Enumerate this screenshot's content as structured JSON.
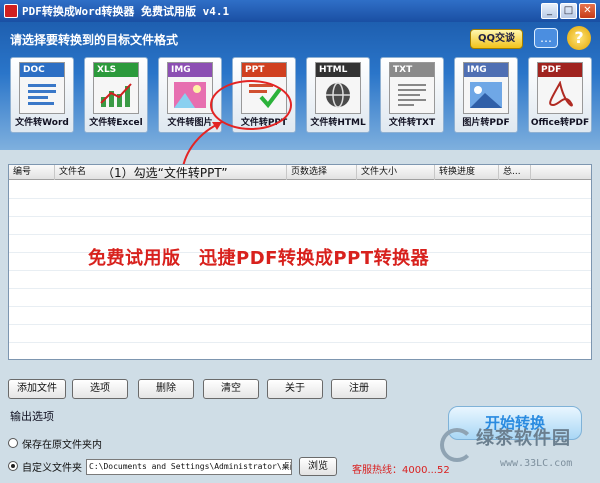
{
  "window": {
    "title": "PDF转换成Word转换器 免费试用版 v4.1"
  },
  "header": {
    "hint": "请选择要转换到的目标文件格式",
    "qq_button": "QQ交谈",
    "help_glyph": "?"
  },
  "tools": [
    {
      "tag": "DOC",
      "label": "文件转Word",
      "tag_color": "#2d6fc4"
    },
    {
      "tag": "XLS",
      "label": "文件转Excel",
      "tag_color": "#2c9a3c"
    },
    {
      "tag": "IMG",
      "label": "文件转图片",
      "tag_color": "#8c4fb3"
    },
    {
      "tag": "PPT",
      "label": "文件转PPT",
      "tag_color": "#d0401f"
    },
    {
      "tag": "HTML",
      "label": "文件转HTML",
      "tag_color": "#333333"
    },
    {
      "tag": "TXT",
      "label": "文件转TXT",
      "tag_color": "#8a8a8a"
    },
    {
      "tag": "IMG",
      "label": "图片转PDF",
      "tag_color": "#4f6fb3"
    },
    {
      "tag": "PDF",
      "label": "Office转PDF",
      "tag_color": "#a0231f"
    }
  ],
  "table": {
    "columns": [
      "编号",
      "文件名",
      "页数选择",
      "文件大小",
      "转换进度",
      "总..."
    ]
  },
  "annotations": {
    "step": "（1）勾选“文件转PPT”",
    "banner": "免费试用版　迅捷PDF转换成PPT转换器"
  },
  "actions": {
    "add_file": "添加文件",
    "options": "选项",
    "delete": "删除",
    "clear": "清空",
    "about": "关于",
    "register": "注册"
  },
  "output": {
    "label": "输出选项",
    "save_original": "保存在原文件夹内",
    "custom_folder": "自定义文件夹",
    "path": "C:\\Documents and Settings\\Administrator\\桌面",
    "browse": "浏览",
    "hotline": "客服热线：4000...52",
    "start": "开始转换"
  },
  "watermark": {
    "name": "绿茶软件园",
    "url": "www.33LC.com"
  }
}
